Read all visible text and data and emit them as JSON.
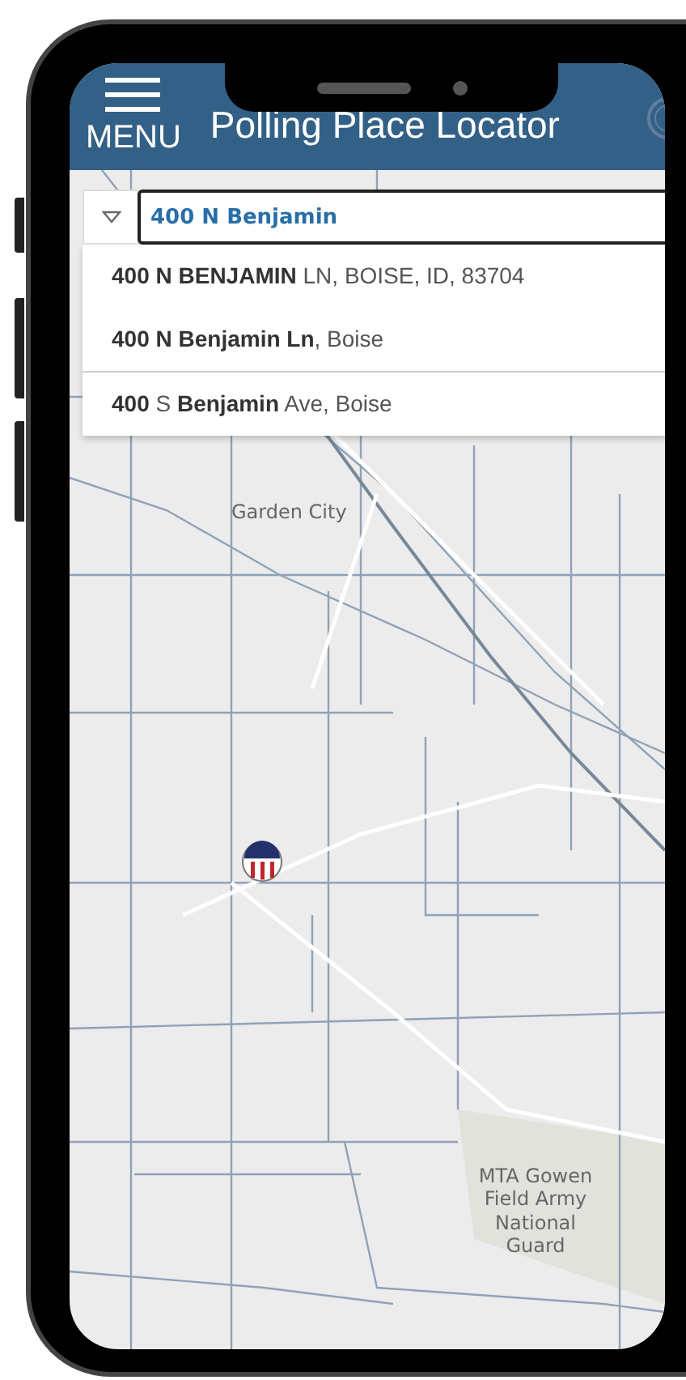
{
  "header": {
    "menu_label": "MENU",
    "title": "Polling Place Locator"
  },
  "search": {
    "value": "400 N Benjamin"
  },
  "suggestions": [
    {
      "text": "**400 N BENJAMIN** LN, BOISE, ID, 83704"
    },
    {
      "text": "**400 N Benjamin Ln**, Boise"
    },
    {
      "text": "**400** S **Benjamin** Ave, Boise"
    }
  ],
  "map": {
    "labels": [
      {
        "kind": "city",
        "text": "Garden City"
      },
      {
        "kind": "area",
        "text": "MTA Gowen Field Army National Guard"
      }
    ]
  }
}
